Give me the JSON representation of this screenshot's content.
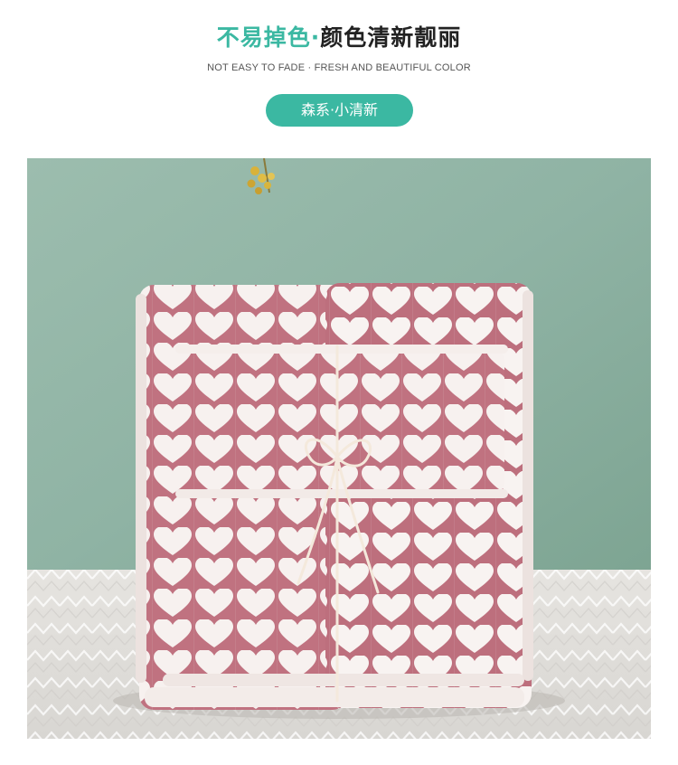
{
  "header": {
    "title_part1": "不易掉色·",
    "title_part2": "颜色清新靓丽",
    "subtitle": "NOT EASY TO FADE · FRESH AND BEAUTIFUL COLOR",
    "tag": "森系·小清新"
  },
  "colors": {
    "accent": "#3bb8a2",
    "wall": "#8fb3a4",
    "towel_pink": "#c07280",
    "towel_white": "#f7f1ef",
    "table_cloth": "#ebe9e6"
  },
  "photo": {
    "subject": "pink-and-white heart pattern towel set tied with ribbon"
  }
}
